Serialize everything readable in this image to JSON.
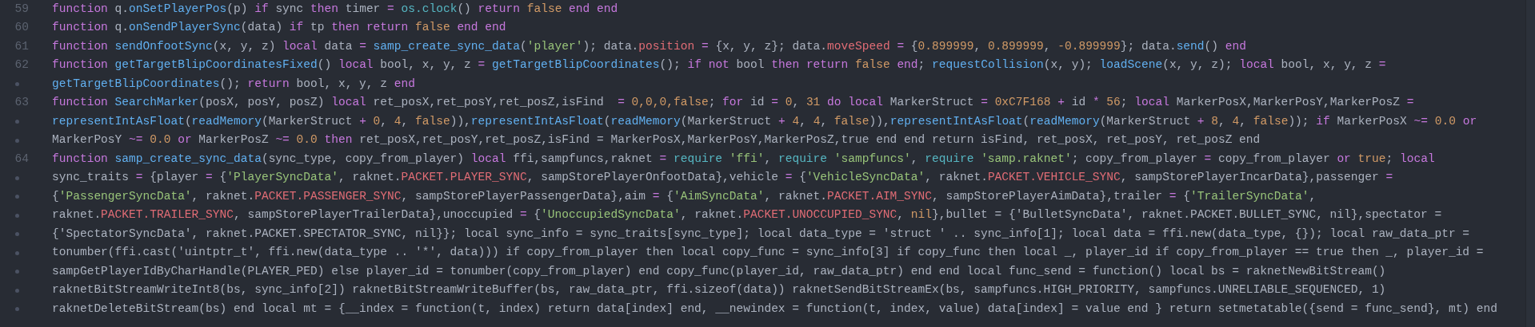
{
  "lines": [
    {
      "number": "59",
      "rows": [
        {
          "segments": [
            {
              "kind": "keyword",
              "text": "function"
            },
            {
              "kind": "plain",
              "text": " q."
            },
            {
              "kind": "function",
              "text": "onSetPlayerPos"
            },
            {
              "kind": "plain",
              "text": "(p) "
            },
            {
              "kind": "keyword",
              "text": "if"
            },
            {
              "kind": "plain",
              "text": " sync "
            },
            {
              "kind": "keyword",
              "text": "then"
            },
            {
              "kind": "plain",
              "text": " timer "
            },
            {
              "kind": "keyword",
              "text": "="
            },
            {
              "kind": "builtin",
              "text": " os.clock"
            },
            {
              "kind": "plain",
              "text": "() "
            },
            {
              "kind": "keyword",
              "text": "return"
            },
            {
              "kind": "constant",
              "text": " false"
            },
            {
              "kind": "keyword",
              "text": " end"
            },
            {
              "kind": "keyword",
              "text": " end"
            }
          ]
        }
      ]
    },
    {
      "number": "60",
      "rows": [
        {
          "segments": [
            {
              "kind": "keyword",
              "text": "function"
            },
            {
              "kind": "plain",
              "text": " q."
            },
            {
              "kind": "function",
              "text": "onSendPlayerSync"
            },
            {
              "kind": "plain",
              "text": "(data) "
            },
            {
              "kind": "keyword",
              "text": "if"
            },
            {
              "kind": "plain",
              "text": " tp "
            },
            {
              "kind": "keyword",
              "text": "then"
            },
            {
              "kind": "keyword",
              "text": " return"
            },
            {
              "kind": "constant",
              "text": " false"
            },
            {
              "kind": "keyword",
              "text": " end"
            },
            {
              "kind": "keyword",
              "text": " end"
            }
          ]
        }
      ]
    },
    {
      "number": "61",
      "rows": [
        {
          "segments": [
            {
              "kind": "keyword",
              "text": "function"
            },
            {
              "kind": "function",
              "text": " sendOnfootSync"
            },
            {
              "kind": "plain",
              "text": "(x, y, z) "
            },
            {
              "kind": "keyword",
              "text": "local"
            },
            {
              "kind": "plain",
              "text": " data "
            },
            {
              "kind": "keyword",
              "text": "="
            },
            {
              "kind": "function",
              "text": " samp_create_sync_data"
            },
            {
              "kind": "plain",
              "text": "("
            },
            {
              "kind": "string",
              "text": "'player'"
            },
            {
              "kind": "plain",
              "text": "); data."
            },
            {
              "kind": "property",
              "text": "position"
            },
            {
              "kind": "keyword",
              "text": " ="
            },
            {
              "kind": "plain",
              "text": " {x, y, z}; data."
            },
            {
              "kind": "property",
              "text": "moveSpeed"
            },
            {
              "kind": "keyword",
              "text": " ="
            },
            {
              "kind": "plain",
              "text": " {"
            },
            {
              "kind": "constant",
              "text": "0.899999"
            },
            {
              "kind": "plain",
              "text": ", "
            },
            {
              "kind": "constant",
              "text": "0.899999"
            },
            {
              "kind": "plain",
              "text": ", "
            },
            {
              "kind": "constant",
              "text": "-0.899999"
            },
            {
              "kind": "plain",
              "text": "}; data."
            },
            {
              "kind": "function",
              "text": "send"
            },
            {
              "kind": "plain",
              "text": "() "
            },
            {
              "kind": "keyword",
              "text": "end"
            }
          ]
        }
      ]
    },
    {
      "number": "62",
      "rows": [
        {
          "segments": [
            {
              "kind": "keyword",
              "text": "function"
            },
            {
              "kind": "function",
              "text": " getTargetBlipCoordinatesFixed"
            },
            {
              "kind": "plain",
              "text": "() "
            },
            {
              "kind": "keyword",
              "text": "local"
            },
            {
              "kind": "plain",
              "text": " bool, x, y, z "
            },
            {
              "kind": "keyword",
              "text": "="
            },
            {
              "kind": "function",
              "text": " getTargetBlipCoordinates"
            },
            {
              "kind": "plain",
              "text": "(); "
            },
            {
              "kind": "keyword",
              "text": "if"
            },
            {
              "kind": "keyword",
              "text": " not"
            },
            {
              "kind": "plain",
              "text": " bool "
            },
            {
              "kind": "keyword",
              "text": "then"
            },
            {
              "kind": "keyword",
              "text": " return"
            },
            {
              "kind": "constant",
              "text": " false"
            },
            {
              "kind": "keyword",
              "text": " end"
            },
            {
              "kind": "plain",
              "text": "; "
            },
            {
              "kind": "function",
              "text": "requestCollision"
            },
            {
              "kind": "plain",
              "text": "(x, y); "
            },
            {
              "kind": "function",
              "text": "loadScene"
            },
            {
              "kind": "plain",
              "text": "(x, y, z); "
            },
            {
              "kind": "keyword",
              "text": "local"
            },
            {
              "kind": "plain",
              "text": " bool, x, y, z "
            },
            {
              "kind": "keyword",
              "text": "="
            }
          ]
        },
        {
          "segments": [
            {
              "kind": "function",
              "text": "getTargetBlipCoordinates"
            },
            {
              "kind": "plain",
              "text": "(); "
            },
            {
              "kind": "keyword",
              "text": "return"
            },
            {
              "kind": "plain",
              "text": " bool, x, y, z "
            },
            {
              "kind": "keyword",
              "text": "end"
            }
          ]
        }
      ]
    },
    {
      "number": "63",
      "rows": [
        {
          "segments": [
            {
              "kind": "keyword",
              "text": "function"
            },
            {
              "kind": "function",
              "text": " SearchMarker"
            },
            {
              "kind": "plain",
              "text": "(posX, posY, posZ) "
            },
            {
              "kind": "keyword",
              "text": "local"
            },
            {
              "kind": "plain",
              "text": " ret_posX,ret_posY,ret_posZ,isFind  "
            },
            {
              "kind": "keyword",
              "text": "="
            },
            {
              "kind": "constant",
              "text": " 0,0,0,false"
            },
            {
              "kind": "plain",
              "text": "; "
            },
            {
              "kind": "keyword",
              "text": "for"
            },
            {
              "kind": "plain",
              "text": " id "
            },
            {
              "kind": "keyword",
              "text": "="
            },
            {
              "kind": "constant",
              "text": " 0"
            },
            {
              "kind": "plain",
              "text": ", "
            },
            {
              "kind": "constant",
              "text": "31"
            },
            {
              "kind": "keyword",
              "text": " do"
            },
            {
              "kind": "keyword",
              "text": " local"
            },
            {
              "kind": "plain",
              "text": " MarkerStruct "
            },
            {
              "kind": "keyword",
              "text": "="
            },
            {
              "kind": "constant",
              "text": " 0xC7F168"
            },
            {
              "kind": "keyword",
              "text": " +"
            },
            {
              "kind": "plain",
              "text": " id "
            },
            {
              "kind": "keyword",
              "text": "*"
            },
            {
              "kind": "constant",
              "text": " 56"
            },
            {
              "kind": "plain",
              "text": "; "
            },
            {
              "kind": "keyword",
              "text": "local"
            },
            {
              "kind": "plain",
              "text": " MarkerPosX,MarkerPosY,MarkerPosZ "
            },
            {
              "kind": "keyword",
              "text": "="
            }
          ]
        },
        {
          "segments": [
            {
              "kind": "function",
              "text": "representIntAsFloat"
            },
            {
              "kind": "plain",
              "text": "("
            },
            {
              "kind": "function",
              "text": "readMemory"
            },
            {
              "kind": "plain",
              "text": "(MarkerStruct "
            },
            {
              "kind": "keyword",
              "text": "+"
            },
            {
              "kind": "constant",
              "text": " 0"
            },
            {
              "kind": "plain",
              "text": ", "
            },
            {
              "kind": "constant",
              "text": "4"
            },
            {
              "kind": "plain",
              "text": ", "
            },
            {
              "kind": "constant",
              "text": "false"
            },
            {
              "kind": "plain",
              "text": ")),"
            },
            {
              "kind": "function",
              "text": "representIntAsFloat"
            },
            {
              "kind": "plain",
              "text": "("
            },
            {
              "kind": "function",
              "text": "readMemory"
            },
            {
              "kind": "plain",
              "text": "(MarkerStruct "
            },
            {
              "kind": "keyword",
              "text": "+"
            },
            {
              "kind": "constant",
              "text": " 4"
            },
            {
              "kind": "plain",
              "text": ", "
            },
            {
              "kind": "constant",
              "text": "4"
            },
            {
              "kind": "plain",
              "text": ", "
            },
            {
              "kind": "constant",
              "text": "false"
            },
            {
              "kind": "plain",
              "text": ")),"
            },
            {
              "kind": "function",
              "text": "representIntAsFloat"
            },
            {
              "kind": "plain",
              "text": "("
            },
            {
              "kind": "function",
              "text": "readMemory"
            },
            {
              "kind": "plain",
              "text": "(MarkerStruct "
            },
            {
              "kind": "keyword",
              "text": "+"
            },
            {
              "kind": "constant",
              "text": " 8"
            },
            {
              "kind": "plain",
              "text": ", "
            },
            {
              "kind": "constant",
              "text": "4"
            },
            {
              "kind": "plain",
              "text": ", "
            },
            {
              "kind": "constant",
              "text": "false"
            },
            {
              "kind": "plain",
              "text": ")); "
            },
            {
              "kind": "keyword",
              "text": "if"
            },
            {
              "kind": "plain",
              "text": " MarkerPosX "
            },
            {
              "kind": "keyword",
              "text": "~="
            },
            {
              "kind": "constant",
              "text": " 0.0"
            },
            {
              "kind": "keyword",
              "text": " or"
            }
          ]
        },
        {
          "segments": [
            {
              "kind": "plain",
              "text": "MarkerPosY "
            },
            {
              "kind": "keyword",
              "text": "~="
            },
            {
              "kind": "constant",
              "text": " 0.0"
            },
            {
              "kind": "keyword",
              "text": " or"
            },
            {
              "kind": "plain",
              "text": " MarkerPosZ "
            },
            {
              "kind": "keyword",
              "text": "~="
            },
            {
              "kind": "constant",
              "text": " 0.0"
            },
            {
              "kind": "keyword",
              "text": " then"
            },
            {
              "kind": "plain",
              "text": " ret_posX,ret_posY,ret_posZ,isFind = MarkerPosX,MarkerPosY,MarkerPosZ,true end end return isFind, ret_posX, ret_posY, ret_posZ end"
            }
          ]
        }
      ]
    },
    {
      "number": "64",
      "rows": [
        {
          "segments": [
            {
              "kind": "keyword",
              "text": "function"
            },
            {
              "kind": "function",
              "text": " samp_create_sync_data"
            },
            {
              "kind": "plain",
              "text": "(sync_type, copy_from_player) "
            },
            {
              "kind": "keyword",
              "text": "local"
            },
            {
              "kind": "plain",
              "text": " ffi,sampfuncs,raknet "
            },
            {
              "kind": "keyword",
              "text": "="
            },
            {
              "kind": "builtin",
              "text": " require"
            },
            {
              "kind": "string",
              "text": " 'ffi'"
            },
            {
              "kind": "plain",
              "text": ", "
            },
            {
              "kind": "builtin",
              "text": "require"
            },
            {
              "kind": "string",
              "text": " 'sampfuncs'"
            },
            {
              "kind": "plain",
              "text": ", "
            },
            {
              "kind": "builtin",
              "text": "require"
            },
            {
              "kind": "string",
              "text": " 'samp.raknet'"
            },
            {
              "kind": "plain",
              "text": "; copy_from_player "
            },
            {
              "kind": "keyword",
              "text": "="
            },
            {
              "kind": "plain",
              "text": " copy_from_player "
            },
            {
              "kind": "keyword",
              "text": "or"
            },
            {
              "kind": "constant",
              "text": " true"
            },
            {
              "kind": "plain",
              "text": "; "
            },
            {
              "kind": "keyword",
              "text": "local"
            }
          ]
        },
        {
          "segments": [
            {
              "kind": "plain",
              "text": "sync_traits "
            },
            {
              "kind": "keyword",
              "text": "="
            },
            {
              "kind": "plain",
              "text": " {player "
            },
            {
              "kind": "keyword",
              "text": "="
            },
            {
              "kind": "plain",
              "text": " {"
            },
            {
              "kind": "string",
              "text": "'PlayerSyncData'"
            },
            {
              "kind": "plain",
              "text": ", raknet."
            },
            {
              "kind": "property",
              "text": "PACKET.PLAYER_SYNC"
            },
            {
              "kind": "plain",
              "text": ", sampStorePlayerOnfootData},vehicle "
            },
            {
              "kind": "keyword",
              "text": "="
            },
            {
              "kind": "plain",
              "text": " {"
            },
            {
              "kind": "string",
              "text": "'VehicleSyncData'"
            },
            {
              "kind": "plain",
              "text": ", raknet."
            },
            {
              "kind": "property",
              "text": "PACKET.VEHICLE_SYNC"
            },
            {
              "kind": "plain",
              "text": ", sampStorePlayerIncarData},passenger "
            },
            {
              "kind": "keyword",
              "text": "="
            }
          ]
        },
        {
          "segments": [
            {
              "kind": "plain",
              "text": "{"
            },
            {
              "kind": "string",
              "text": "'PassengerSyncData'"
            },
            {
              "kind": "plain",
              "text": ", raknet."
            },
            {
              "kind": "property",
              "text": "PACKET.PASSENGER_SYNC"
            },
            {
              "kind": "plain",
              "text": ", sampStorePlayerPassengerData},aim "
            },
            {
              "kind": "keyword",
              "text": "="
            },
            {
              "kind": "plain",
              "text": " {"
            },
            {
              "kind": "string",
              "text": "'AimSyncData'"
            },
            {
              "kind": "plain",
              "text": ", raknet."
            },
            {
              "kind": "property",
              "text": "PACKET.AIM_SYNC"
            },
            {
              "kind": "plain",
              "text": ", sampStorePlayerAimData},trailer "
            },
            {
              "kind": "keyword",
              "text": "="
            },
            {
              "kind": "plain",
              "text": " {"
            },
            {
              "kind": "string",
              "text": "'TrailerSyncData'"
            },
            {
              "kind": "plain",
              "text": ","
            }
          ]
        },
        {
          "segments": [
            {
              "kind": "plain",
              "text": "raknet."
            },
            {
              "kind": "property",
              "text": "PACKET.TRAILER_SYNC"
            },
            {
              "kind": "plain",
              "text": ", sampStorePlayerTrailerData},unoccupied "
            },
            {
              "kind": "keyword",
              "text": "="
            },
            {
              "kind": "plain",
              "text": " {"
            },
            {
              "kind": "string",
              "text": "'UnoccupiedSyncData'"
            },
            {
              "kind": "plain",
              "text": ", raknet."
            },
            {
              "kind": "property",
              "text": "PACKET.UNOCCUPIED_SYNC"
            },
            {
              "kind": "plain",
              "text": ", "
            },
            {
              "kind": "constant",
              "text": "nil"
            },
            {
              "kind": "plain",
              "text": "},bullet = {'BulletSyncData', raknet.PACKET.BULLET_SYNC, nil},spectator ="
            }
          ]
        },
        {
          "segments": [
            {
              "kind": "plain",
              "text": "{'SpectatorSyncData', raknet.PACKET.SPECTATOR_SYNC, nil}}; local sync_info = sync_traits[sync_type]; local data_type = 'struct ' .. sync_info[1]; local data = ffi.new(data_type, {}); local raw_data_ptr ="
            }
          ]
        },
        {
          "segments": [
            {
              "kind": "plain",
              "text": "tonumber(ffi.cast('uintptr_t', ffi.new(data_type .. '*', data))) if copy_from_player then local copy_func = sync_info[3] if copy_func then local _, player_id if copy_from_player == true then _, player_id ="
            }
          ]
        },
        {
          "segments": [
            {
              "kind": "plain",
              "text": "sampGetPlayerIdByCharHandle(PLAYER_PED) else player_id = tonumber(copy_from_player) end copy_func(player_id, raw_data_ptr) end end local func_send = function() local bs = raknetNewBitStream()"
            }
          ]
        },
        {
          "segments": [
            {
              "kind": "plain",
              "text": "raknetBitStreamWriteInt8(bs, sync_info[2]) raknetBitStreamWriteBuffer(bs, raw_data_ptr, ffi.sizeof(data)) raknetSendBitStreamEx(bs, sampfuncs.HIGH_PRIORITY, sampfuncs.UNRELIABLE_SEQUENCED, 1)"
            }
          ]
        },
        {
          "segments": [
            {
              "kind": "plain",
              "text": "raknetDeleteBitStream(bs) end local mt = {__index = function(t, index) return data[index] end, __newindex = function(t, index, value) data[index] = value end } return setmetatable({send = func_send}, mt) end"
            }
          ]
        }
      ]
    }
  ]
}
